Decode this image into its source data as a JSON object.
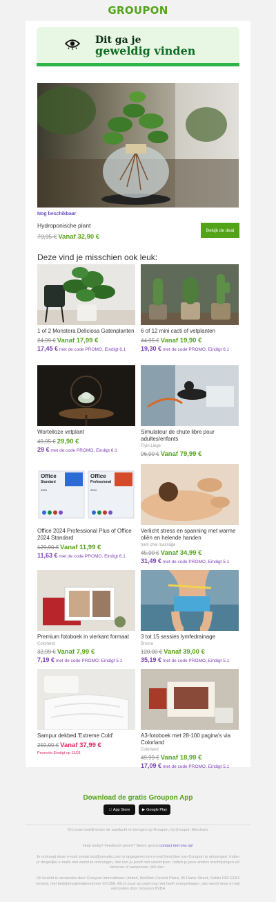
{
  "brand": {
    "logo_text": "GROUPON",
    "color": "#53a318"
  },
  "banner": {
    "line1": "Dit ga je",
    "line2": "geweldig vinden",
    "icon": "eye-icon"
  },
  "featured": {
    "availability": "Nog beschikbaar",
    "title": "Hydroponische plant",
    "old_price": "79,95 €",
    "new_price": "Vanaf 32,90 €",
    "cta": "Bekijk de deal"
  },
  "section_title": "Deze vind je misschien ook leuk:",
  "products": [
    {
      "name": "1 of 2 Monstera Deliciosa Gatenplanten",
      "merchant": "",
      "old_price": "24,99 €",
      "new_price": "Vanaf 17,99 €",
      "promo_price": "17,45 €",
      "promo_text": "met de code PROMO, Eindigt 6.1"
    },
    {
      "name": "6 of 12 mini cacti of vetplanten",
      "merchant": "",
      "old_price": "44,95 €",
      "new_price": "Vanaf 19,90 €",
      "promo_price": "19,30 €",
      "promo_text": "met de code PROMO, Eindigt 6.1"
    },
    {
      "name": "Wortelloze vetplant",
      "merchant": "",
      "old_price": "49,95 €",
      "new_price": "29,90 €",
      "promo_price": "29 €",
      "promo_text": "met de code PROMO, Eindigt 6.1"
    },
    {
      "name": "Simulateur de chute libre pour adultes/enfants",
      "merchant": "Flyin Liège",
      "old_price": "96,00 €",
      "new_price": "Vanaf 79,99 €",
      "promo_price": "",
      "promo_text": ""
    },
    {
      "name": "Office 2024 Professional Plus of Office 2024 Standard",
      "merchant": "",
      "old_price": "129,90 €",
      "new_price": "Vanaf 11,99 €",
      "promo_price": "11,63 €",
      "promo_text": "met de code PROMO, Eindigt 6.1"
    },
    {
      "name": "Verlicht stress en spanning met warme oliën en helende handen",
      "merchant": "nam chai massage",
      "old_price": "45,00 €",
      "new_price": "Vanaf 34,99 €",
      "promo_price": "31,49 €",
      "promo_text": "met de code PROMO, Eindigt 5.1"
    },
    {
      "name": "Premium fotoboek in vierkant formaat",
      "merchant": "Colorland",
      "old_price": "32,99 €",
      "new_price": "Vanaf 7,99 €",
      "promo_price": "7,19 €",
      "promo_text": "met de code PROMO, Eindigt 5.1"
    },
    {
      "name": "3 tot 15 sessies lymfedrainage",
      "merchant": "Bruma",
      "old_price": "120,00 €",
      "new_price": "Vanaf 39,00 €",
      "promo_price": "35,19 €",
      "promo_text": "met de code PROMO, Eindigt 5.1"
    },
    {
      "name": "Sampur dekbed 'Extreme Cold'",
      "merchant": "",
      "old_price": "259,00 €",
      "new_price": "Vanaf 37,99 €",
      "promo_price": "",
      "promo_text": "",
      "ends": "Promotie Eindigt op 11/01",
      "price_color": "#e0245e"
    },
    {
      "name": "A3-fotoboek met 28-100 pagina's via Colorland",
      "merchant": "Colorland",
      "old_price": "49,99 €",
      "new_price": "Vanaf 18,99 €",
      "promo_price": "17,09 €",
      "promo_text": "met de code PROMO, Eindigt 5.1"
    }
  ],
  "office_labels": {
    "standard": "Office",
    "standard_sub": "Standard",
    "pro": "Office",
    "pro_sub": "Professional",
    "year": "2024"
  },
  "footer": {
    "app_title": "Download de gratis Groupon App",
    "app_store": "App Store",
    "google_play": "Google Play",
    "merchant_line": "Om jouw bedrijf onder de aandacht te brengen op Groupon, bij Groupon Merchant.",
    "help_prefix": "Hulp nodig? Feedback geven? Neem gerust",
    "help_link": "contact met ons op!",
    "subscription": "Je ontvangt deze e-mail omdat xxx@ureader.com is opgegeven om e-mail berichten van Groupon te ontvangen. Indien je dergelijke e-mails niet wenst te ontvangen, dan kun je jezelf met uitschrijven. Indien je jouw andere inschrijvingen wil beheren of aanpassen, klik dan .",
    "legal": "Dit bericht is verzonden door Groupon International Limited, WeWork Central Plaza, 36 Dame Street, Dublin D02 EF64 Ierland, met bedrijfsregistratienummer 501358. Als je jouw account nog niet heeft overgedragen, dan wordt deze e-mail verzonden door Groupon BVBA"
  }
}
